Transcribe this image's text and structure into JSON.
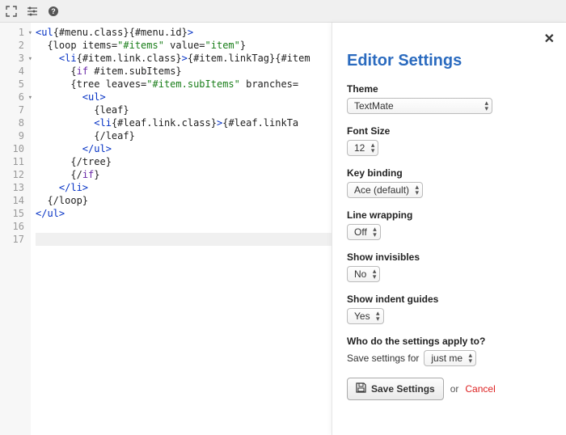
{
  "toolbar": {
    "fullscreen_title": "Fullscreen",
    "settings_title": "Settings",
    "help_title": "Help"
  },
  "editor": {
    "lines": [
      {
        "n": 1,
        "fold": true,
        "hl": false,
        "html": "<span class='tag'>&lt;ul</span><span class='text'>{#menu.class}{#menu.id}</span><span class='tag'>&gt;</span>"
      },
      {
        "n": 2,
        "fold": false,
        "hl": false,
        "html": "  <span class='text'>{loop items=</span><span class='string'>\"#items\"</span><span class='text'> value=</span><span class='string'>\"item\"</span><span class='text'>}</span>"
      },
      {
        "n": 3,
        "fold": true,
        "hl": false,
        "html": "    <span class='tag'>&lt;li</span><span class='text'>{#item.link.class}</span><span class='tag'>&gt;</span><span class='text'>{#item.linkTag}{#item</span>"
      },
      {
        "n": 4,
        "fold": false,
        "hl": false,
        "html": "      <span class='text'>{</span><span class='keyword'>if</span><span class='text'> #item.subItems}</span>"
      },
      {
        "n": 5,
        "fold": false,
        "hl": false,
        "html": "      <span class='text'>{tree leaves=</span><span class='string'>\"#item.subItems\"</span><span class='text'> branches=</span>"
      },
      {
        "n": 6,
        "fold": true,
        "hl": false,
        "html": "        <span class='tag'>&lt;ul&gt;</span>"
      },
      {
        "n": 7,
        "fold": false,
        "hl": false,
        "html": "          <span class='text'>{leaf}</span>"
      },
      {
        "n": 8,
        "fold": false,
        "hl": false,
        "html": "          <span class='tag'>&lt;li</span><span class='text'>{#leaf.link.class}</span><span class='tag'>&gt;</span><span class='text'>{#leaf.linkTa</span>"
      },
      {
        "n": 9,
        "fold": false,
        "hl": false,
        "html": "          <span class='text'>{/leaf}</span>"
      },
      {
        "n": 10,
        "fold": false,
        "hl": false,
        "html": "        <span class='tag'>&lt;/ul&gt;</span>"
      },
      {
        "n": 11,
        "fold": false,
        "hl": false,
        "html": "      <span class='text'>{/tree}</span>"
      },
      {
        "n": 12,
        "fold": false,
        "hl": false,
        "html": "      <span class='text'>{/</span><span class='keyword'>if</span><span class='text'>}</span>"
      },
      {
        "n": 13,
        "fold": false,
        "hl": false,
        "html": "    <span class='tag'>&lt;/li&gt;</span>"
      },
      {
        "n": 14,
        "fold": false,
        "hl": false,
        "html": "  <span class='text'>{/loop}</span>"
      },
      {
        "n": 15,
        "fold": false,
        "hl": false,
        "html": "<span class='tag'>&lt;/ul&gt;</span>"
      },
      {
        "n": 16,
        "fold": false,
        "hl": false,
        "html": ""
      },
      {
        "n": 17,
        "fold": false,
        "hl": true,
        "html": ""
      }
    ]
  },
  "panel": {
    "title": "Editor Settings",
    "theme_label": "Theme",
    "theme_value": "TextMate",
    "fontsize_label": "Font Size",
    "fontsize_value": "12",
    "keybinding_label": "Key binding",
    "keybinding_value": "Ace (default)",
    "linewrap_label": "Line wrapping",
    "linewrap_value": "Off",
    "invisibles_label": "Show invisibles",
    "invisibles_value": "No",
    "indent_label": "Show indent guides",
    "indent_value": "Yes",
    "apply_label": "Who do the settings apply to?",
    "apply_prefix": "Save settings for",
    "apply_value": "just me",
    "save_label": "Save Settings",
    "or_label": "or",
    "cancel_label": "Cancel"
  }
}
